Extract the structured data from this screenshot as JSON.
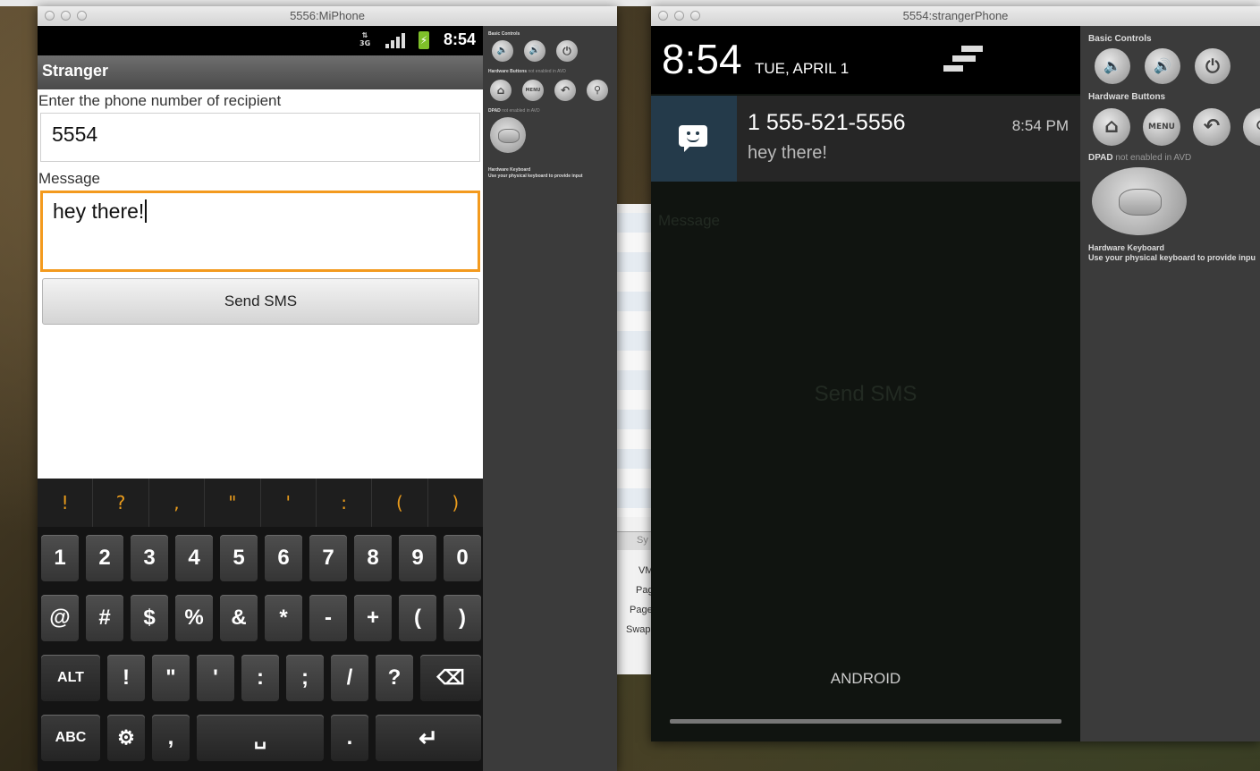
{
  "left_window": {
    "title": "5556:MiPhone",
    "status": {
      "network": "3G",
      "time": "8:54"
    },
    "app_title": "Stranger",
    "recipient_label": "Enter the phone number of recipient",
    "recipient_value": "5554",
    "message_label": "Message",
    "message_value": "hey there!",
    "send_button": "Send SMS",
    "keyboard": {
      "suggestions": [
        "!",
        "?",
        ",",
        "\"",
        "'",
        ":",
        "(",
        ")"
      ],
      "row1": [
        "1",
        "2",
        "3",
        "4",
        "5",
        "6",
        "7",
        "8",
        "9",
        "0"
      ],
      "row2": [
        "@",
        "#",
        "$",
        "%",
        "&",
        "*",
        "-",
        "+",
        "(",
        ")"
      ],
      "row3": [
        "ALT",
        "!",
        "\"",
        "'",
        ":",
        ";",
        "/",
        "?",
        "⌫"
      ],
      "row4": [
        "ABC",
        "⚙",
        ",",
        "␣",
        ".",
        "↵"
      ]
    },
    "controls": {
      "basic_controls": "Basic Controls",
      "hardware_buttons": "Hardware Buttons",
      "hardware_buttons_note": "not enabled in AVD",
      "dpad": "DPAD",
      "dpad_note": "not enabled in AVD",
      "hardware_keyboard": "Hardware Keyboard",
      "keyboard_note": "Use your physical keyboard to provide input",
      "menu_label": "MENU"
    }
  },
  "right_window": {
    "title": "5554:strangerPhone",
    "time": "8:54",
    "date": "TUE, APRIL 1",
    "notification": {
      "title": "1 555-521-5556",
      "time": "8:54 PM",
      "text": "hey there!"
    },
    "carrier": "ANDROID",
    "background_button": "Send SMS",
    "background_label": "Message",
    "controls": {
      "basic_controls": "Basic Controls",
      "hardware_buttons": "Hardware Buttons",
      "dpad": "DPAD",
      "dpad_note": "not enabled in AVD",
      "hardware_keyboard": "Hardware Keyboard",
      "keyboard_note": "Use your physical keyboard to provide inpu",
      "menu_label": "MENU"
    }
  },
  "background_window": {
    "tab": "Sy",
    "items": [
      "VM",
      "Pag",
      "Page",
      "Swap"
    ]
  },
  "colors": {
    "focus_border": "#f39a1e",
    "suggestion_text": "#e99b1c",
    "notification_icon_bg": "#243a4a",
    "battery": "#7fc02a"
  }
}
